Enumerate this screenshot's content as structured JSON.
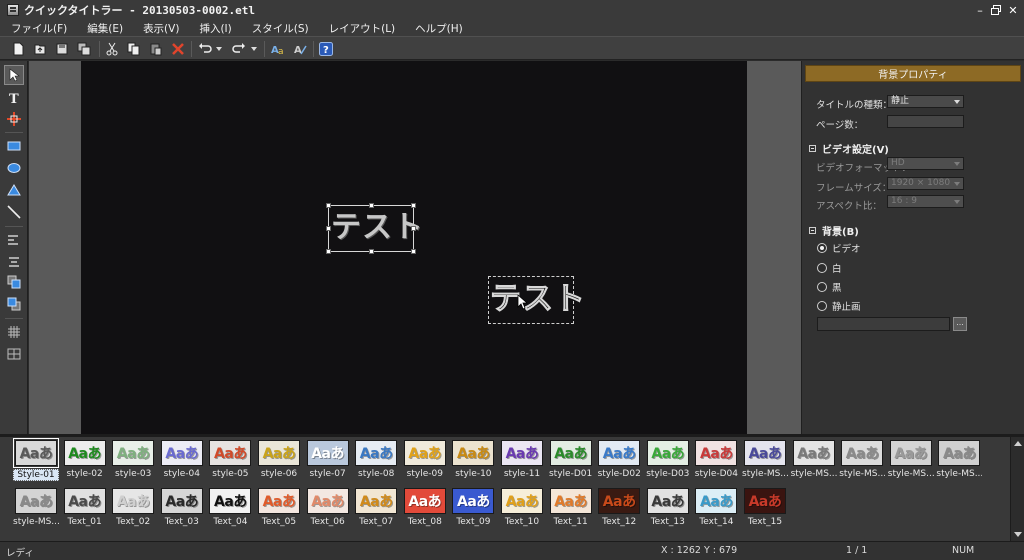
{
  "app": {
    "title": "クイックタイトラー - 20130503-0002.etl"
  },
  "window_controls": [
    "minimize-icon",
    "restore-icon",
    "close-icon"
  ],
  "menu": [
    {
      "label": "ファイル(F)"
    },
    {
      "label": "編集(E)"
    },
    {
      "label": "表示(V)"
    },
    {
      "label": "挿入(I)"
    },
    {
      "label": "スタイル(S)"
    },
    {
      "label": "レイアウト(L)"
    },
    {
      "label": "ヘルプ(H)"
    }
  ],
  "toolbar_icons": [
    "new-file-icon",
    "open-file-icon",
    "save-icon",
    "save-as-icon",
    "cut-icon",
    "copy-icon",
    "paste-icon",
    "delete-icon",
    "undo-icon",
    "undo-dropdown-icon",
    "redo-icon",
    "redo-dropdown-icon",
    "text-style-icon",
    "text-effect-icon",
    "help-icon"
  ],
  "left_tools": [
    "select-icon",
    "text-icon",
    "crop-icon",
    "rectangle-icon",
    "ellipse-icon",
    "triangle-icon",
    "line-icon",
    "align-left-icon",
    "align-center-icon",
    "bring-forward-icon",
    "send-backward-icon",
    "grid-icon",
    "safe-area-icon"
  ],
  "canvas": {
    "text_1": "テスト",
    "text_2": "テスト",
    "background_color": "#111012"
  },
  "properties": {
    "header": "背景プロパティ",
    "title_type_label": "タイトルの種類：",
    "title_type_value": "静止",
    "page_count_label": "ページ数：",
    "page_count_value": "",
    "video_section": "ビデオ設定(V)",
    "video_format_label": "ビデオフォーマット：",
    "video_format_value": "HD",
    "frame_size_label": "フレームサイズ：",
    "frame_size_value": "1920 × 1080",
    "aspect_label": "アスペクト比：",
    "aspect_value": "16 : 9",
    "background_section": "背景(B)",
    "bg_options": [
      {
        "label": "ビデオ",
        "selected": true
      },
      {
        "label": "白",
        "selected": false
      },
      {
        "label": "黒",
        "selected": false
      },
      {
        "label": "静止画",
        "selected": false
      }
    ],
    "path_value": "",
    "browse_label": "..."
  },
  "gallery": {
    "row1": [
      {
        "name": "Style-01",
        "fg": "#5a5a5a",
        "bg": "#d9d9d9",
        "selected": true
      },
      {
        "name": "style-02",
        "fg": "#1f8a1f",
        "bg": "#ececec"
      },
      {
        "name": "style-03",
        "fg": "#7fb07f",
        "bg": "#e8efe8"
      },
      {
        "name": "style-04",
        "fg": "#6a6ad0",
        "bg": "#ececf5"
      },
      {
        "name": "style-05",
        "fg": "#d04a2a",
        "bg": "#e6e2e0"
      },
      {
        "name": "style-06",
        "fg": "#c9a31a",
        "bg": "#eae6d8"
      },
      {
        "name": "style-07",
        "fg": "#ffffff",
        "bg": "#b9c8dc"
      },
      {
        "name": "style-08",
        "fg": "#3a78c2",
        "bg": "#e6ecf3"
      },
      {
        "name": "style-09",
        "fg": "#e0a21a",
        "bg": "#f0eadb"
      },
      {
        "name": "style-10",
        "fg": "#c88a14",
        "bg": "#ece3cf"
      },
      {
        "name": "style-11",
        "fg": "#6a3ab0",
        "bg": "#ebe6f3"
      },
      {
        "name": "style-D01",
        "fg": "#2a8a2a",
        "bg": "#e2ece2"
      },
      {
        "name": "style-D02",
        "fg": "#3a7ac8",
        "bg": "#e2eaf3"
      },
      {
        "name": "style-D03",
        "fg": "#3aa83a",
        "bg": "#e4efe4"
      },
      {
        "name": "style-D04",
        "fg": "#c83a3a",
        "bg": "#f1e2e2"
      },
      {
        "name": "style-MS...",
        "fg": "#4a4a9a",
        "bg": "#e4e4ee"
      },
      {
        "name": "style-MS...",
        "fg": "#7a7a7a",
        "bg": "#e4e4e4"
      },
      {
        "name": "style-MS...",
        "fg": "#8a8a8a",
        "bg": "#dcdcdc"
      },
      {
        "name": "style-MS...",
        "fg": "#9a9a9a",
        "bg": "#d4d4d4"
      },
      {
        "name": "style-MS...",
        "fg": "#8a8a8a",
        "bg": "#d0d0d0"
      }
    ],
    "row2": [
      {
        "name": "style-MS...",
        "fg": "#8a8a8a",
        "bg": "#d4d4d4"
      },
      {
        "name": "Text_01",
        "fg": "#4a4a4a",
        "bg": "#e0e0e0"
      },
      {
        "name": "Text_02",
        "fg": "#cfcfcf",
        "bg": "#e6e6e6"
      },
      {
        "name": "Text_03",
        "fg": "#2a2a2a",
        "bg": "#d6d6d6"
      },
      {
        "name": "Text_04",
        "fg": "#111111",
        "bg": "#f2f2f2"
      },
      {
        "name": "Text_05",
        "fg": "#e05a2a",
        "bg": "#f3e6df"
      },
      {
        "name": "Text_06",
        "fg": "#e08a6a",
        "bg": "#f3e8e2"
      },
      {
        "name": "Text_07",
        "fg": "#d08a1a",
        "bg": "#f1e6d3"
      },
      {
        "name": "Text_08",
        "fg": "#ffffff",
        "bg": "#e24a3a"
      },
      {
        "name": "Text_09",
        "fg": "#ffffff",
        "bg": "#3a5ad0"
      },
      {
        "name": "Text_10",
        "fg": "#e0a01a",
        "bg": "#f6eed9"
      },
      {
        "name": "Text_11",
        "fg": "#e07a2a",
        "bg": "#f4e6d8"
      },
      {
        "name": "Text_12",
        "fg": "#c84a1a",
        "bg": "#3a1a12"
      },
      {
        "name": "Text_13",
        "fg": "#3a3a3a",
        "bg": "#e2e2e2"
      },
      {
        "name": "Text_14",
        "fg": "#3a9ac8",
        "bg": "#dceef6"
      },
      {
        "name": "Text_15",
        "fg": "#c83a2a",
        "bg": "#3a1410"
      }
    ]
  },
  "status": {
    "left": "レディ",
    "coords": "X : 1262  Y : 679",
    "page": "1 / 1",
    "num": "NUM"
  }
}
